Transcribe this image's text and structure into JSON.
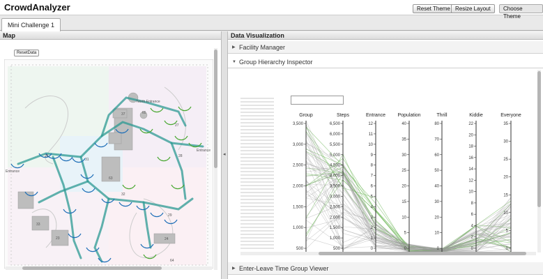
{
  "app": {
    "title": "CrowdAnalyzer"
  },
  "toolbar": {
    "reset_theme": "Reset Theme",
    "resize_layout": "Resize Layout",
    "choose_theme": "Choose Theme"
  },
  "tabs": [
    {
      "label": "Mini Challenge 1"
    }
  ],
  "map": {
    "header": "Map",
    "reset_data": "ResetData",
    "labels": {
      "north_entrance": "North Entrance",
      "entrance_w": "Entrance",
      "entrance_e": "Entrance"
    },
    "attraction_ids": [
      "37",
      "65",
      "27",
      "31",
      "63",
      "32",
      "33",
      "25",
      "28",
      "29",
      "24",
      "64",
      "23",
      "22",
      "42",
      "43",
      "53",
      "30",
      "38",
      "34",
      "62",
      "21",
      "39",
      "36",
      "20",
      "35",
      "26",
      "1",
      "4"
    ],
    "colors": {
      "trail": "#2c9a93",
      "blue_arc": "#1f6fb8",
      "green_arc": "#4aa832"
    }
  },
  "data_viz": {
    "header": "Data Visualization",
    "sections": [
      {
        "label": "Facility Manager",
        "expanded": false
      },
      {
        "label": "Group Hierarchy Inspector",
        "expanded": true
      },
      {
        "label": "Enter-Leave Time Group Viewer",
        "expanded": false
      }
    ],
    "parallel_coords": {
      "axes": [
        {
          "label": "Group",
          "ticks": [
            "3,500",
            "3,000",
            "2,500",
            "2,000",
            "1,500",
            "1,000",
            "500"
          ]
        },
        {
          "label": "Steps",
          "ticks": [
            "6,500",
            "6,000",
            "5,500",
            "5,000",
            "4,500",
            "4,000",
            "3,500",
            "3,000",
            "2,500",
            "2,000",
            "1,500",
            "1,000",
            "500"
          ]
        },
        {
          "label": "Entrance",
          "ticks": [
            "12",
            "11",
            "10",
            "9",
            "8",
            "7",
            "6",
            "5",
            "4",
            "3",
            "2",
            "1",
            "0"
          ]
        },
        {
          "label": "Population",
          "ticks": [
            "40",
            "35",
            "30",
            "25",
            "20",
            "15",
            "10",
            "5",
            "0"
          ]
        },
        {
          "label": "Thrill",
          "ticks": [
            "80",
            "70",
            "60",
            "50",
            "40",
            "30",
            "20",
            "10",
            "0"
          ]
        },
        {
          "label": "Kiddie",
          "ticks": [
            "22",
            "20",
            "18",
            "16",
            "14",
            "12",
            "10",
            "8",
            "6",
            "4",
            "2",
            "0"
          ]
        },
        {
          "label": "Everyone",
          "ticks": [
            "35",
            "30",
            "25",
            "20",
            "15",
            "10",
            "5",
            "0"
          ]
        }
      ],
      "colors": {
        "line_gray": "#9a9a9a",
        "line_green": "#6fb85a",
        "axis": "#333333"
      }
    }
  }
}
